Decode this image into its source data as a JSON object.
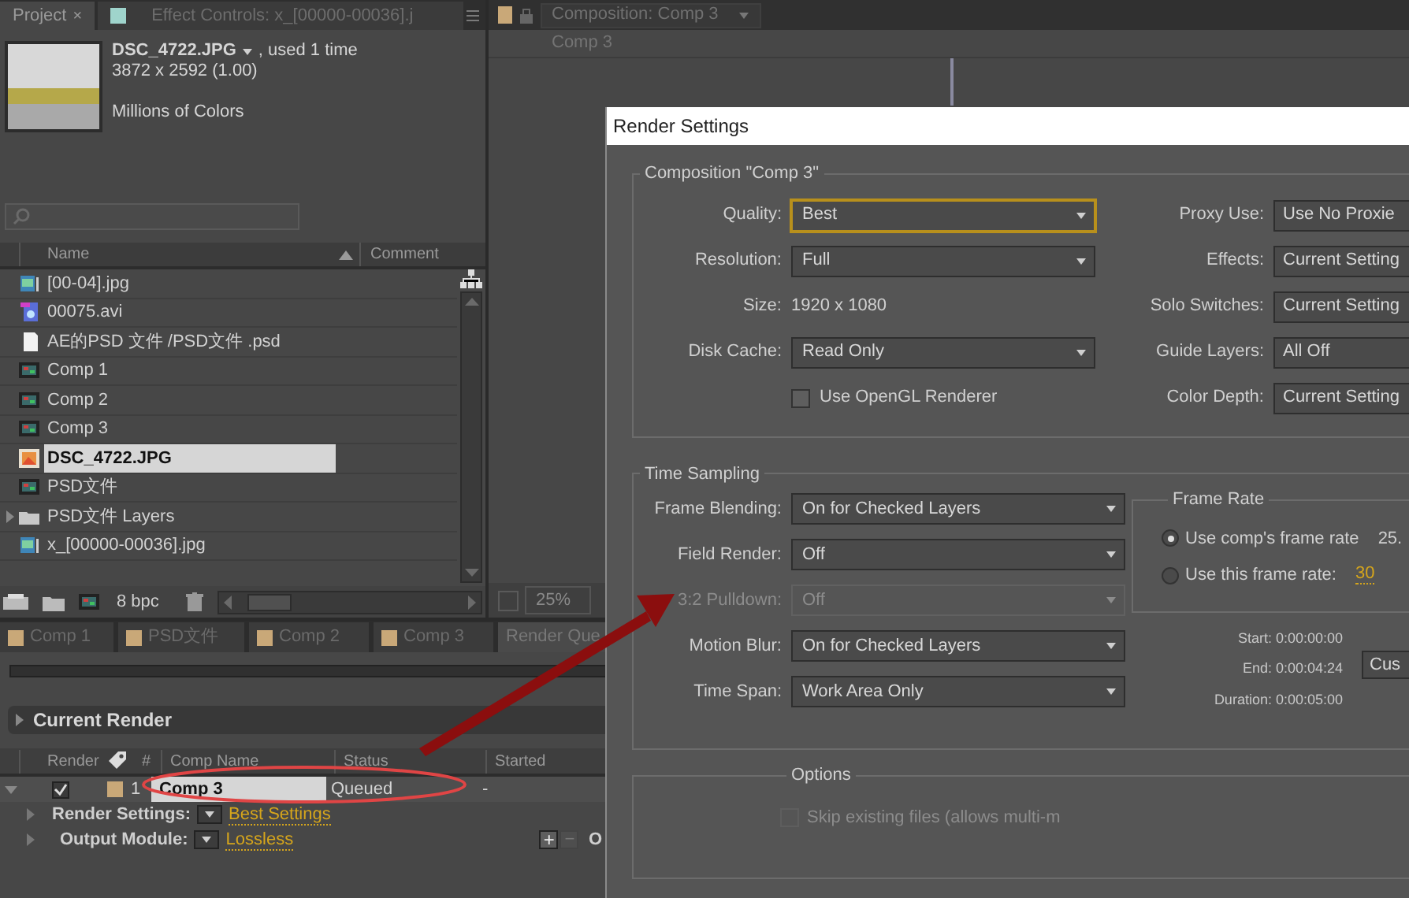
{
  "project_panel": {
    "tabs": [
      {
        "label": "Project",
        "close": "×",
        "selected": true
      },
      {
        "label": "Effect Controls: x_[00000-00036].j",
        "selected": false
      }
    ],
    "info": {
      "name": "DSC_4722.JPG",
      "usage": ", used 1 time",
      "dimensions": "3872 x 2592 (1.00)",
      "colors": "Millions of Colors"
    },
    "columns": [
      "Name",
      "Comment"
    ],
    "items": [
      {
        "name": "[00-04].jpg",
        "kind": "sequence",
        "selected": false
      },
      {
        "name": "00075.avi",
        "kind": "video",
        "selected": false
      },
      {
        "name": "AE的PSD 文件 /PSD文件 .psd",
        "kind": "document",
        "selected": false
      },
      {
        "name": "Comp 1",
        "kind": "comp",
        "selected": false
      },
      {
        "name": "Comp 2",
        "kind": "comp",
        "selected": false
      },
      {
        "name": "Comp 3",
        "kind": "comp",
        "selected": false
      },
      {
        "name": "DSC_4722.JPG",
        "kind": "image",
        "selected": true
      },
      {
        "name": "PSD文件",
        "kind": "comp",
        "selected": false
      },
      {
        "name": "PSD文件  Layers",
        "kind": "folder",
        "selected": false
      },
      {
        "name": "x_[00000-00036].jpg",
        "kind": "sequence",
        "selected": false
      }
    ],
    "bit_depth": "8 bpc"
  },
  "viewer": {
    "tab": "Composition: Comp 3",
    "breadcrumb": "Comp 3",
    "zoom": "25%"
  },
  "render_queue": {
    "tabs": [
      {
        "label": "Comp 1",
        "selected": false
      },
      {
        "label": "PSD文件",
        "selected": false
      },
      {
        "label": "Comp 2",
        "selected": false
      },
      {
        "label": "Comp 3",
        "selected": false
      },
      {
        "label": "Render Que",
        "selected": true
      }
    ],
    "progress": {
      "level": 0
    },
    "current_render": "Current Render",
    "columns": [
      "Render",
      "#",
      "Comp Name",
      "Status",
      "Started"
    ],
    "items": [
      {
        "render": true,
        "number": "1",
        "comp_name": "Comp 3",
        "status": "Queued",
        "started": "-",
        "selected": true,
        "render_settings": {
          "label": "Render Settings:",
          "value": "Best Settings"
        },
        "output_module": {
          "label": "Output Module:",
          "value": "Lossless"
        },
        "add": "+",
        "remove": "−",
        "output_to": "O"
      }
    ]
  },
  "dialog": {
    "title": "Render Settings",
    "composition": {
      "title": "Composition \"Comp 3\"",
      "left": [
        {
          "kind": "dropdown",
          "label": "Quality:",
          "value": "Best",
          "focused": true
        },
        {
          "kind": "dropdown",
          "label": "Resolution:",
          "value": "Full",
          "focused": false
        },
        {
          "kind": "text",
          "label": "Size:",
          "value": "1920 x 1080"
        },
        {
          "kind": "dropdown",
          "label": "Disk Cache:",
          "value": "Read Only",
          "focused": false
        },
        {
          "kind": "checkbox",
          "label": "Use OpenGL Renderer",
          "checked": false
        }
      ],
      "right": [
        {
          "kind": "dropdown",
          "label": "Proxy Use:",
          "value": "Use No Proxie"
        },
        {
          "kind": "dropdown",
          "label": "Effects:",
          "value": "Current Setting"
        },
        {
          "kind": "dropdown",
          "label": "Solo Switches:",
          "value": "Current Setting"
        },
        {
          "kind": "dropdown",
          "label": "Guide Layers:",
          "value": "All Off"
        },
        {
          "kind": "dropdown",
          "label": "Color Depth:",
          "value": "Current Setting"
        }
      ]
    },
    "time_sampling": {
      "title": "Time Sampling",
      "rows": [
        {
          "label": "Frame Blending:",
          "value": "On for Checked Layers",
          "disabled": false
        },
        {
          "label": "Field Render:",
          "value": "Off",
          "disabled": false
        },
        {
          "label": "3:2 Pulldown:",
          "value": "Off",
          "disabled": true
        },
        {
          "label": "Motion Blur:",
          "value": "On for Checked Layers",
          "disabled": false
        },
        {
          "label": "Time Span:",
          "value": "Work Area Only",
          "disabled": false
        }
      ],
      "frame_rate": {
        "title": "Frame Rate",
        "options": [
          {
            "label": "Use comp's frame rate",
            "value": "25.",
            "selected": true
          },
          {
            "label": "Use this frame rate:",
            "value": "30",
            "selected": false
          }
        ]
      },
      "span": [
        {
          "label": "Start:",
          "value": "0:00:00:00"
        },
        {
          "label": "End:",
          "value": "0:00:04:24"
        },
        {
          "label": "Duration:",
          "value": "0:00:05:00"
        }
      ],
      "custom_button": "Cus"
    },
    "options": {
      "title": "Options",
      "items": [
        {
          "label": "Skip existing files (allows multi-m",
          "checked": false,
          "disabled": true
        }
      ]
    }
  }
}
